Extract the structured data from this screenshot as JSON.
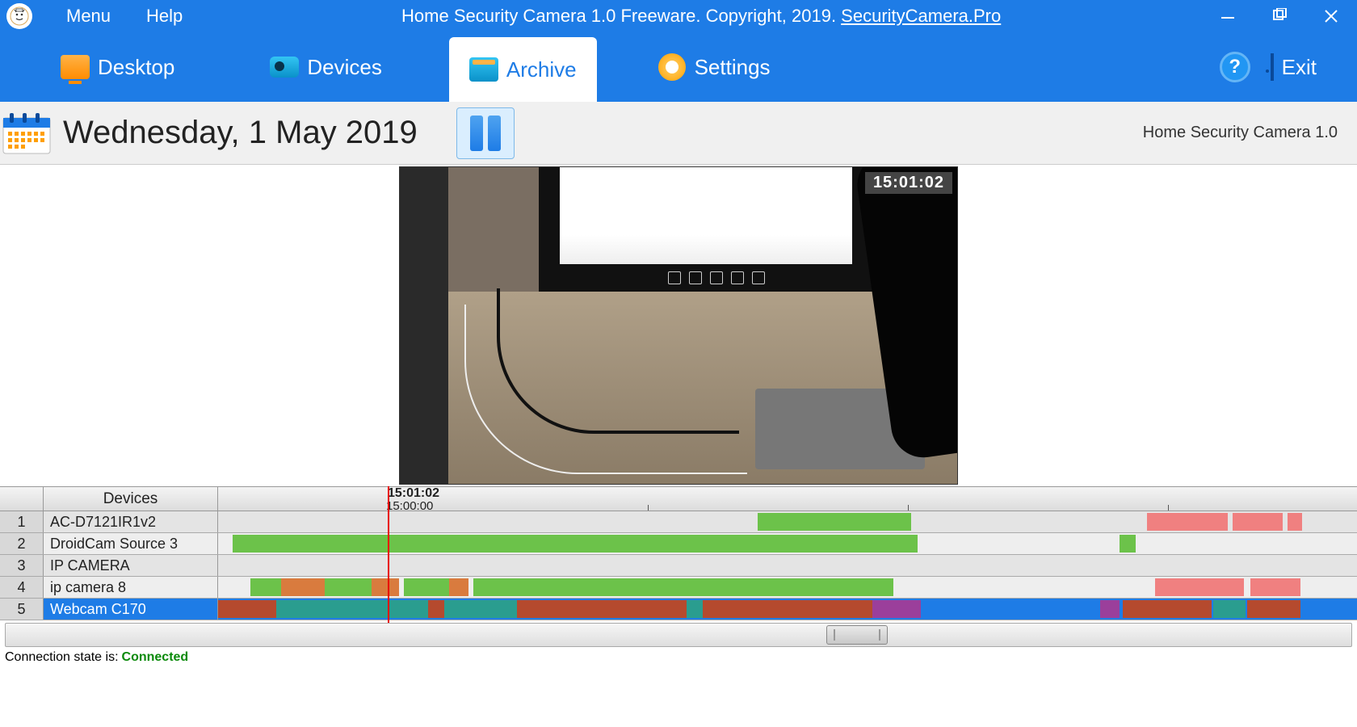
{
  "titlebar": {
    "menu": "Menu",
    "help": "Help",
    "title_prefix": "Home Security Camera 1.0 Freeware. Copyright, 2019. ",
    "title_link": "SecurityCamera.Pro"
  },
  "tabs": {
    "desktop": "Desktop",
    "devices": "Devices",
    "archive": "Archive",
    "settings": "Settings",
    "exit": "Exit",
    "help_symbol": "?"
  },
  "daterow": {
    "date": "Wednesday, 1 May 2019",
    "app_name": "Home Security Camera 1.0"
  },
  "video": {
    "overlay_time": "15:01:02"
  },
  "timeline": {
    "devices_header": "Devices",
    "playhead_label": "15:01:02",
    "ruler_label": "15:00:00",
    "rows": [
      {
        "idx": "1",
        "name": "AC-D7121IR1v2"
      },
      {
        "idx": "2",
        "name": "DroidCam Source 3"
      },
      {
        "idx": "3",
        "name": "IP CAMERA"
      },
      {
        "idx": "4",
        "name": "ip camera 8"
      },
      {
        "idx": "5",
        "name": "Webcam C170"
      }
    ]
  },
  "status": {
    "label": "Connection state is:",
    "value": "Connected"
  }
}
